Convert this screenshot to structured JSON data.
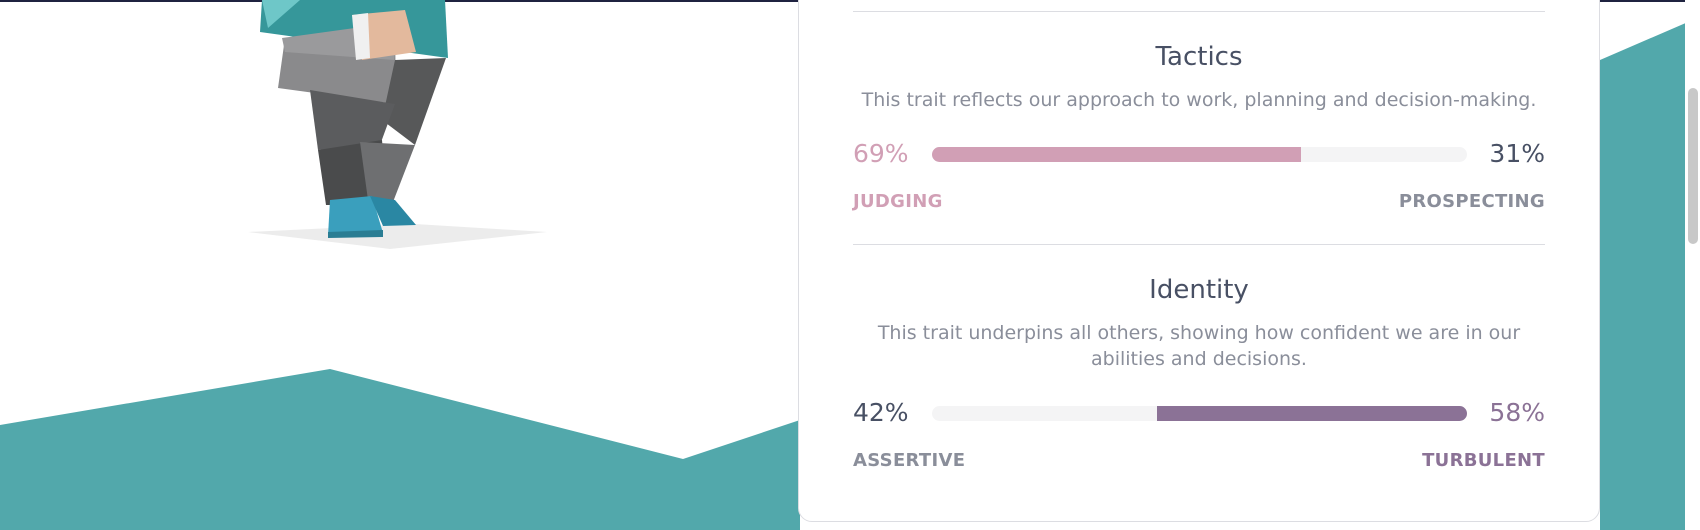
{
  "colors": {
    "teal_bg": "#52a8ab",
    "judging": "#d19fb5",
    "turbulent": "#8b7296",
    "dark_text": "#485064",
    "muted_text": "#8a8e9a"
  },
  "illustration": {
    "icon": "person-figure-illustration"
  },
  "traits": [
    {
      "title": "Tactics",
      "description": "This trait reflects our approach to work, planning and decision-making.",
      "left_percent": "69%",
      "right_percent": "31%",
      "left_label": "JUDGING",
      "right_label": "PROSPECTING",
      "dominant": "left",
      "fill_fraction": 0.69
    },
    {
      "title": "Identity",
      "description": "This trait underpins all others, showing how confident we are in our abilities and decisions.",
      "left_percent": "42%",
      "right_percent": "58%",
      "left_label": "ASSERTIVE",
      "right_label": "TURBULENT",
      "dominant": "right",
      "fill_fraction": 0.58
    }
  ]
}
